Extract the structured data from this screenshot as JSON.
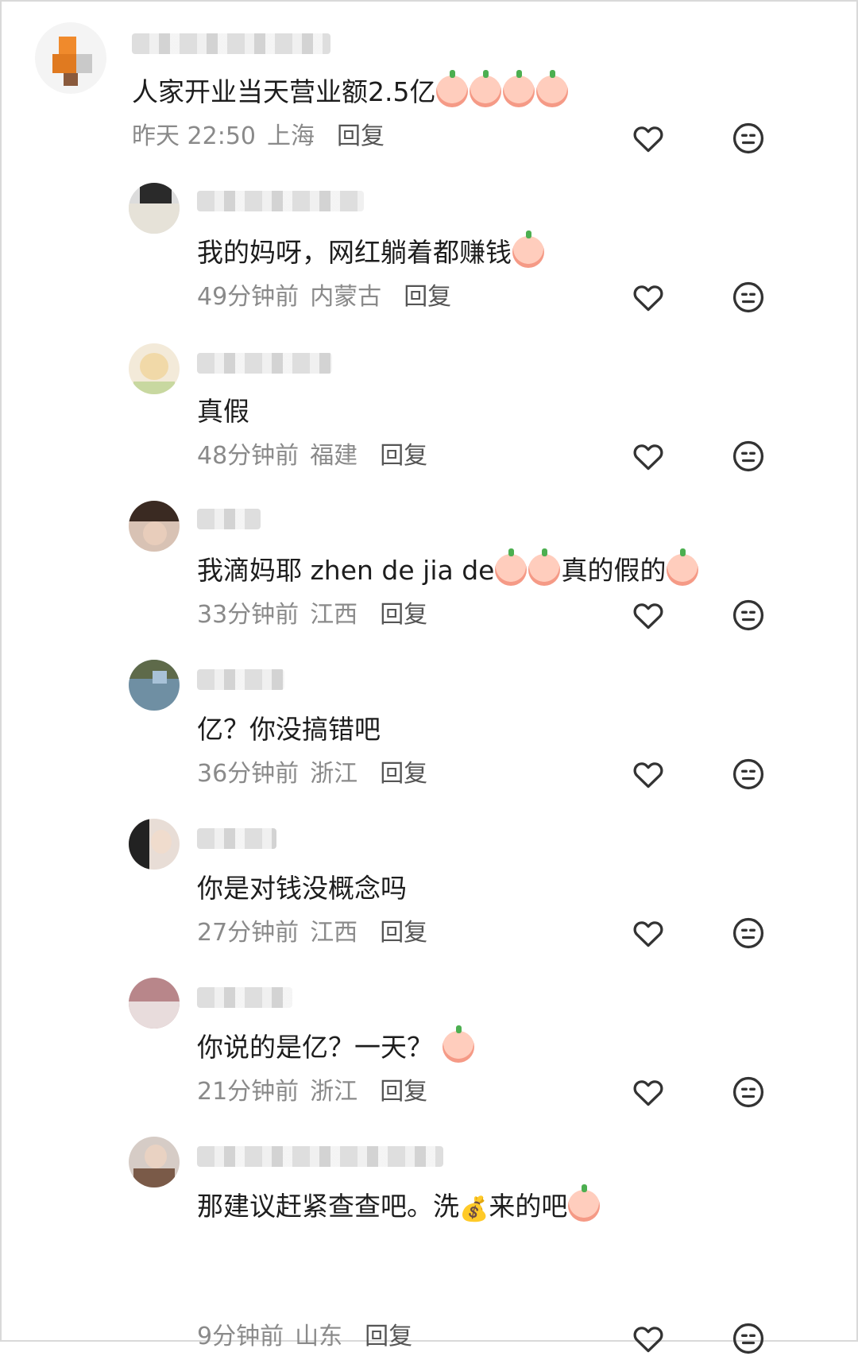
{
  "comments": [
    {
      "text": "人家开业当天营业额2.5亿",
      "time": "昨天 22:50",
      "location": "上海",
      "reply": "回复",
      "emoji_count": 4
    },
    {
      "text": "我的妈呀，网红躺着都赚钱",
      "time": "49分钟前",
      "location": "内蒙古",
      "reply": "回复",
      "emoji_count": 1
    },
    {
      "text": "真假",
      "time": "48分钟前",
      "location": "福建",
      "reply": "回复",
      "emoji_count": 0
    },
    {
      "text_a": "我滴妈耶 zhen de jia de",
      "text_b": "真的假的",
      "time": "33分钟前",
      "location": "江西",
      "reply": "回复"
    },
    {
      "text": "亿？你没搞错吧",
      "time": "36分钟前",
      "location": "浙江",
      "reply": "回复",
      "emoji_count": 0
    },
    {
      "text": "你是对钱没概念吗",
      "time": "27分钟前",
      "location": "江西",
      "reply": "回复",
      "emoji_count": 0
    },
    {
      "text": "你说的是亿？一天？",
      "time": "21分钟前",
      "location": "浙江",
      "reply": "回复",
      "emoji_count": 1
    },
    {
      "text_a": "那建议赶紧查查吧。洗",
      "text_b": "来的吧",
      "time": "9分钟前",
      "location": "山东",
      "reply": "回复"
    }
  ],
  "icons": {
    "like": "heart-icon",
    "reaction": "face-icon",
    "money": "money-bag-icon"
  }
}
